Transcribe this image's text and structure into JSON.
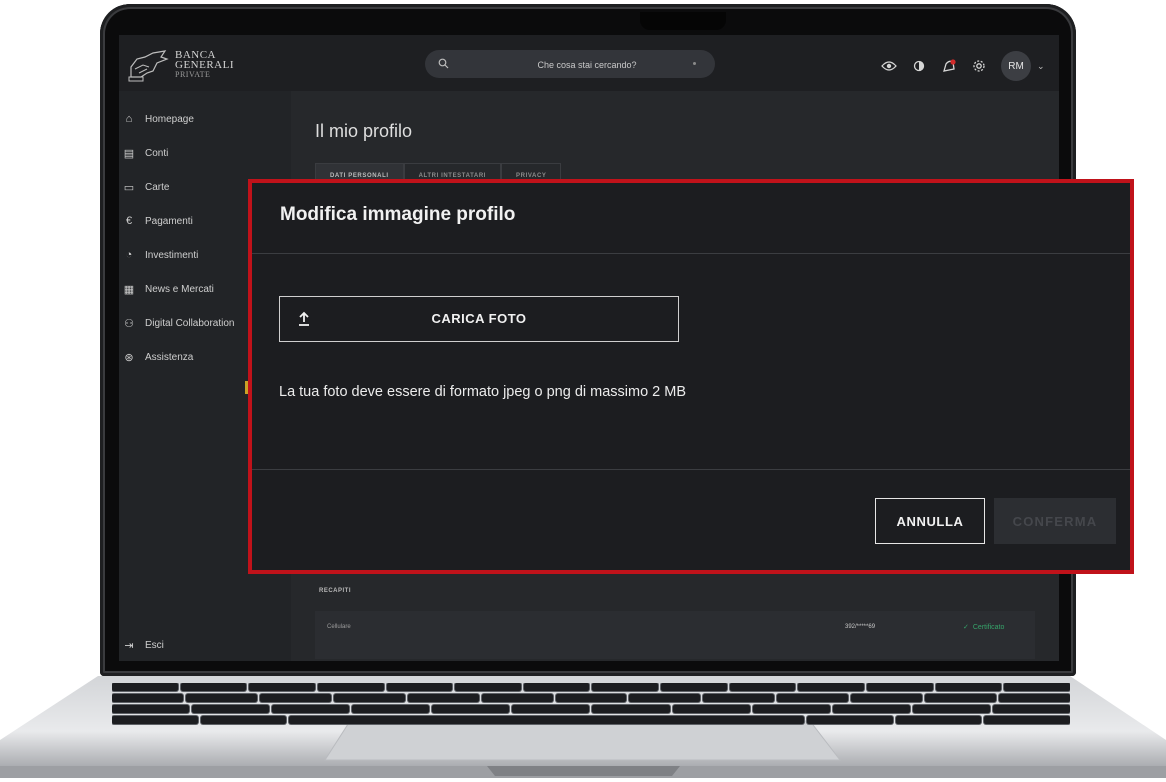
{
  "header": {
    "logo": {
      "line1": "BANCA",
      "line2": "GENERALI",
      "line3": "PRIVATE"
    },
    "search_placeholder": "Che cosa stai cercando?",
    "avatar_initials": "RM"
  },
  "sidebar": {
    "items": [
      {
        "label": "Homepage",
        "icon": "home-icon"
      },
      {
        "label": "Conti",
        "icon": "database-icon"
      },
      {
        "label": "Carte",
        "icon": "card-icon"
      },
      {
        "label": "Pagamenti",
        "icon": "euro-icon"
      },
      {
        "label": "Investimenti",
        "icon": "pie-chart-icon"
      },
      {
        "label": "News e Mercati",
        "icon": "newspaper-icon"
      },
      {
        "label": "Digital Collaboration",
        "icon": "collaboration-icon"
      },
      {
        "label": "Assistenza",
        "icon": "lifebuoy-icon"
      }
    ],
    "logout_label": "Esci"
  },
  "main": {
    "page_title": "Il mio profilo",
    "tabs": [
      "DATI PERSONALI",
      "ALTRI INTESTATARI",
      "PRIVACY"
    ],
    "section_label": "RECAPITI",
    "row": {
      "label": "Cellulare",
      "value": "392/*****69",
      "status": "Certificato"
    }
  },
  "modal": {
    "title": "Modifica immagine profilo",
    "upload_label": "CARICA FOTO",
    "hint": "La tua foto deve essere di formato jpeg o png di massimo 2 MB",
    "cancel_label": "ANNULLA",
    "confirm_label": "CONFERMA",
    "highlight_color": "#c0121a"
  },
  "colors": {
    "background": "#25272a",
    "status_ok": "#36a36a",
    "flag": "#c9a227"
  }
}
